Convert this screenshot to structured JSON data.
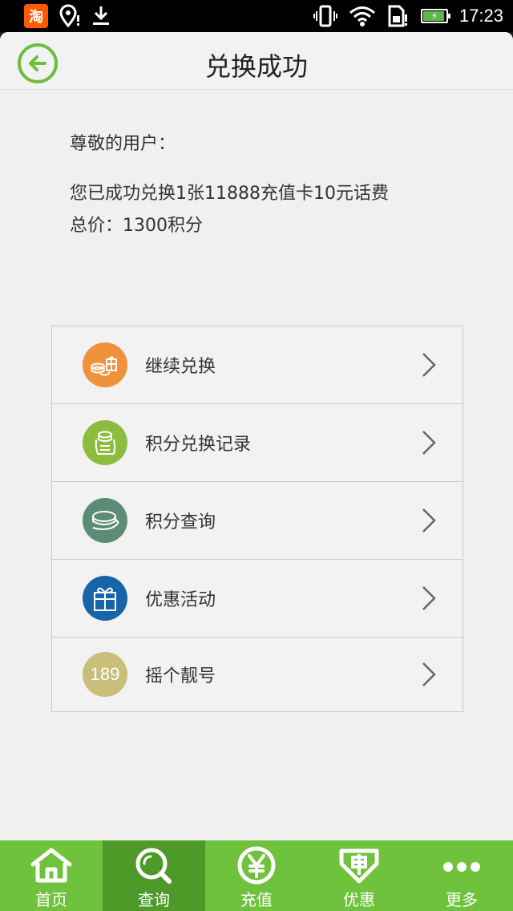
{
  "status_bar": {
    "taobao_label": "淘",
    "time": "17:23"
  },
  "header": {
    "title": "兑换成功"
  },
  "message": {
    "greeting": "尊敬的用户：",
    "detail": "您已成功兑换1张11888充值卡10元话费",
    "total": "总价：1300积分"
  },
  "menu": [
    {
      "label": "继续兑换",
      "icon": "exchange-coins-gift-icon",
      "color": "#f0913c"
    },
    {
      "label": "积分兑换记录",
      "icon": "coin-record-icon",
      "color": "#8dbd3e"
    },
    {
      "label": "积分查询",
      "icon": "coins-stack-icon",
      "color": "#5c8c77"
    },
    {
      "label": "优惠活动",
      "icon": "gift-box-icon",
      "color": "#1565a8"
    },
    {
      "label": "摇个靓号",
      "icon": "number-189-icon",
      "color": "#c8bf7b",
      "icon_text": "189"
    }
  ],
  "bottom_nav": [
    {
      "label": "首页",
      "icon": "home-icon",
      "active": false
    },
    {
      "label": "查询",
      "icon": "search-icon",
      "active": true
    },
    {
      "label": "充值",
      "icon": "yuan-icon",
      "active": false
    },
    {
      "label": "优惠",
      "icon": "discount-tag-icon",
      "active": false
    },
    {
      "label": "更多",
      "icon": "more-icon",
      "active": false
    }
  ],
  "colors": {
    "accent": "#6fc23c",
    "accent_dark": "#4d9a28",
    "background": "#f0f0f0"
  }
}
